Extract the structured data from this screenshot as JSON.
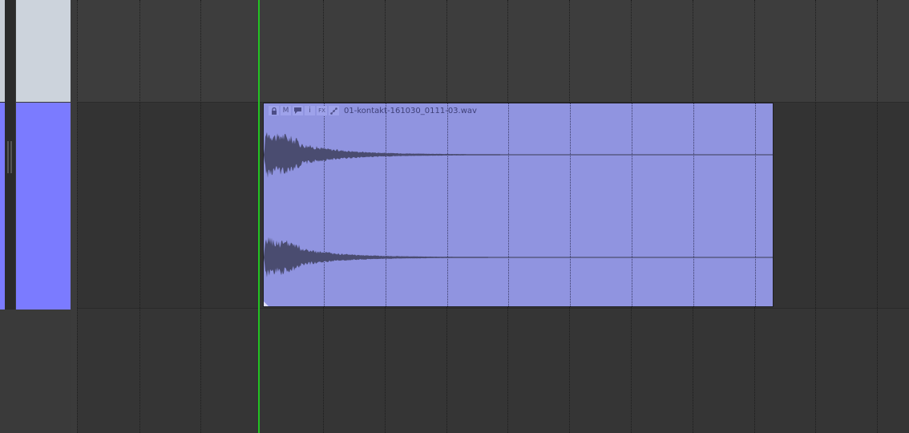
{
  "item": {
    "name": "01-kontakt-161030_0111-03.wav",
    "buttons": [
      {
        "icon": "lock-icon",
        "glyph": "🔒"
      },
      {
        "icon": "mute-icon",
        "glyph": "M"
      },
      {
        "icon": "notes-icon",
        "glyph": "▬"
      },
      {
        "icon": "info-icon",
        "glyph": "i"
      },
      {
        "icon": "fx-icon",
        "glyph": "FX"
      },
      {
        "icon": "envelope-icon",
        "glyph": "↗"
      }
    ]
  },
  "colors": {
    "item_fill": "#9094e0",
    "track_color": "#7b7bff",
    "playhead": "#22c322",
    "waveform": "#4a4c70"
  }
}
